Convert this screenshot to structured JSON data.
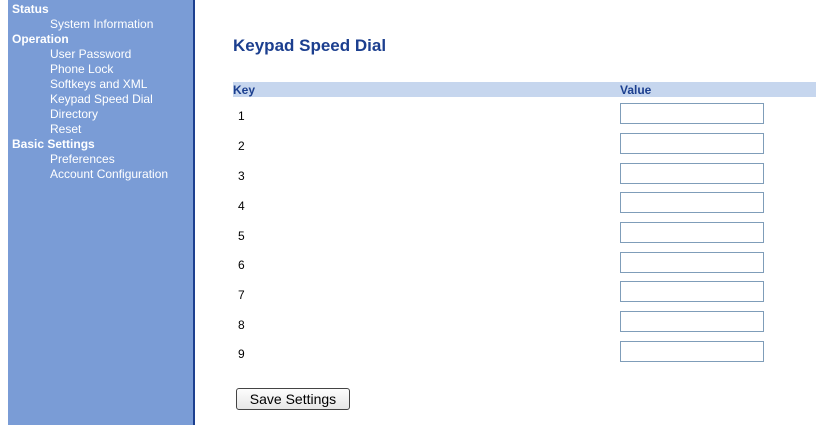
{
  "sidebar": {
    "sections": [
      {
        "label": "Status",
        "items": [
          {
            "label": "System Information"
          }
        ]
      },
      {
        "label": "Operation",
        "items": [
          {
            "label": "User Password"
          },
          {
            "label": "Phone Lock"
          },
          {
            "label": "Softkeys and XML"
          },
          {
            "label": "Keypad Speed Dial"
          },
          {
            "label": "Directory"
          },
          {
            "label": "Reset"
          }
        ]
      },
      {
        "label": "Basic Settings",
        "items": [
          {
            "label": "Preferences"
          },
          {
            "label": "Account Configuration"
          }
        ]
      }
    ]
  },
  "main": {
    "title": "Keypad Speed Dial",
    "columns": {
      "key": "Key",
      "value": "Value"
    },
    "rows": [
      {
        "key": "1",
        "value": ""
      },
      {
        "key": "2",
        "value": ""
      },
      {
        "key": "3",
        "value": ""
      },
      {
        "key": "4",
        "value": ""
      },
      {
        "key": "5",
        "value": ""
      },
      {
        "key": "6",
        "value": ""
      },
      {
        "key": "7",
        "value": ""
      },
      {
        "key": "8",
        "value": ""
      },
      {
        "key": "9",
        "value": ""
      }
    ],
    "save_label": "Save Settings"
  },
  "colors": {
    "sidebar_bg": "#7a9cd6",
    "title": "#1c3f8f",
    "table_header_bg": "#c6d6ee"
  }
}
